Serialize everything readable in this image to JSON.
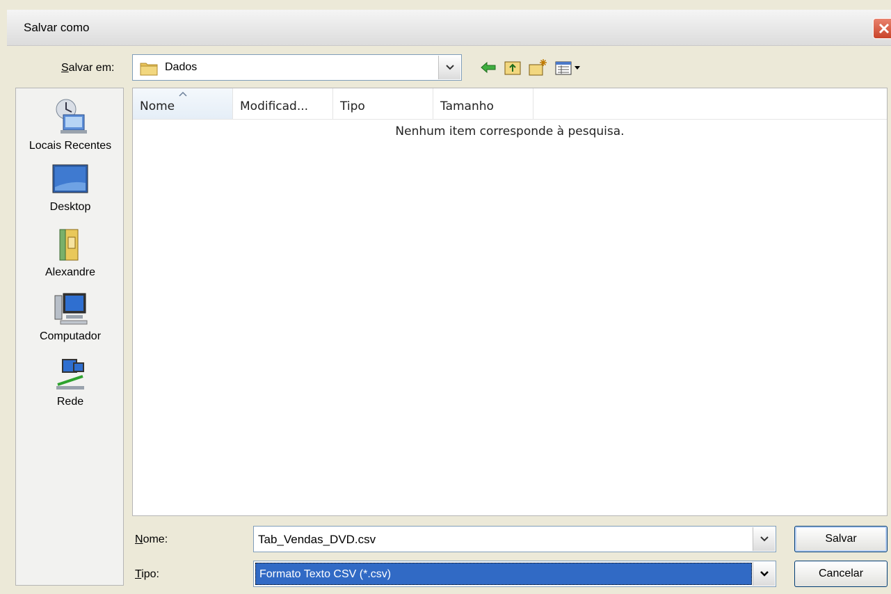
{
  "window": {
    "title": "Salvar como"
  },
  "lookin": {
    "label": "Salvar em:",
    "value": "Dados"
  },
  "toolbar": {
    "icons": [
      "back-arrow-icon",
      "up-folder-icon",
      "new-folder-icon",
      "view-menu-icon"
    ]
  },
  "places": [
    {
      "label": "Locais Recentes",
      "icon": "recent-places-icon"
    },
    {
      "label": "Desktop",
      "icon": "desktop-icon"
    },
    {
      "label": "Alexandre",
      "icon": "user-folder-icon"
    },
    {
      "label": "Computador",
      "icon": "computer-icon"
    },
    {
      "label": "Rede",
      "icon": "network-icon"
    }
  ],
  "filelist": {
    "columns": [
      "Nome",
      "Modificad...",
      "Tipo",
      "Tamanho"
    ],
    "sorted_column": "Nome",
    "empty_message": "Nenhum item corresponde à pesquisa."
  },
  "filename": {
    "label": "Nome:",
    "value": "Tab_Vendas_DVD.csv"
  },
  "filetype": {
    "label": "Tipo:",
    "value": "Formato Texto CSV (*.csv)"
  },
  "buttons": {
    "save": "Salvar",
    "cancel": "Cancelar"
  },
  "colors": {
    "accent": "#316ac5",
    "close": "#c9442a",
    "dialog_bg": "#ece9d8"
  }
}
